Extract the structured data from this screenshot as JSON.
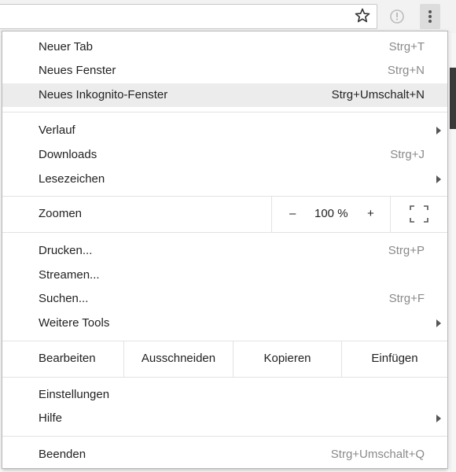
{
  "menu": {
    "group1": [
      {
        "label": "Neuer Tab",
        "shortcut": "Strg+T"
      },
      {
        "label": "Neues Fenster",
        "shortcut": "Strg+N"
      },
      {
        "label": "Neues Inkognito-Fenster",
        "shortcut": "Strg+Umschalt+N"
      }
    ],
    "group2": [
      {
        "label": "Verlauf",
        "has_submenu": true
      },
      {
        "label": "Downloads",
        "shortcut": "Strg+J"
      },
      {
        "label": "Lesezeichen",
        "has_submenu": true
      }
    ],
    "zoom": {
      "label": "Zoomen",
      "minus": "–",
      "value": "100 %",
      "plus": "+"
    },
    "group3": [
      {
        "label": "Drucken...",
        "shortcut": "Strg+P"
      },
      {
        "label": "Streamen..."
      },
      {
        "label": "Suchen...",
        "shortcut": "Strg+F"
      },
      {
        "label": "Weitere Tools",
        "has_submenu": true
      }
    ],
    "edit": {
      "label": "Bearbeiten",
      "cut": "Ausschneiden",
      "copy": "Kopieren",
      "paste": "Einfügen"
    },
    "group4": [
      {
        "label": "Einstellungen"
      },
      {
        "label": "Hilfe",
        "has_submenu": true
      }
    ],
    "group5": [
      {
        "label": "Beenden",
        "shortcut": "Strg+Umschalt+Q"
      }
    ],
    "hovered_item": "Neues Inkognito-Fenster"
  },
  "icons": {
    "bookmark": "star-icon",
    "extension": "shield-icon",
    "menu": "three-dots-icon",
    "fullscreen": "fullscreen-icon"
  },
  "colors": {
    "hover_bg": "#ececec",
    "shortcut_text": "#8a8a8a"
  }
}
